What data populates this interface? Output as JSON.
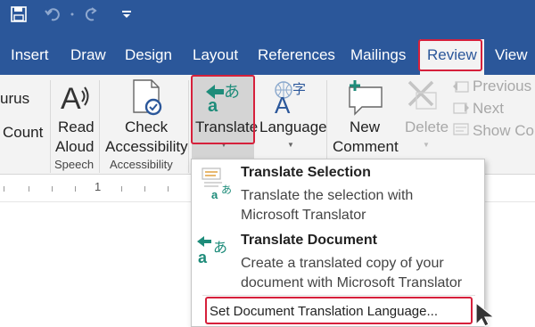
{
  "quick_access": {
    "icons": [
      "save-icon",
      "undo-icon",
      "redo-icon",
      "customize-icon"
    ]
  },
  "tabs": [
    "Insert",
    "Draw",
    "Design",
    "Layout",
    "References",
    "Mailings",
    "Review",
    "View"
  ],
  "active_tab": "Review",
  "ribbon": {
    "thesaurus_partial": "urus",
    "word_count_partial": "Count",
    "read_aloud": {
      "line1": "Read",
      "line2": "Aloud"
    },
    "speech_group": "Speech",
    "check_accessibility": {
      "line1": "Check",
      "line2": "Accessibility"
    },
    "accessibility_group": "Accessibility",
    "translate": "Translate",
    "language": "Language",
    "new_comment": {
      "line1": "New",
      "line2": "Comment"
    },
    "delete": "Delete",
    "previous": "Previous",
    "next": "Next",
    "show_comments_partial": "Show Con"
  },
  "ruler": {
    "number": "1"
  },
  "translate_menu": {
    "items": [
      {
        "title": "Translate Selection",
        "desc1": "Translate the selection with",
        "desc2": "Microsoft Translator",
        "icon": "translate-selection-icon"
      },
      {
        "title": "Translate Document",
        "desc1": "Create a translated copy of your",
        "desc2": "document with Microsoft Translator",
        "icon": "translate-document-icon"
      }
    ],
    "set_language": "Set Document Translation Language..."
  },
  "colors": {
    "brand": "#2b579a",
    "highlight": "#d6203b",
    "ribbon_bg": "#f3f3f3",
    "icon_teal": "#1e8c7a"
  }
}
